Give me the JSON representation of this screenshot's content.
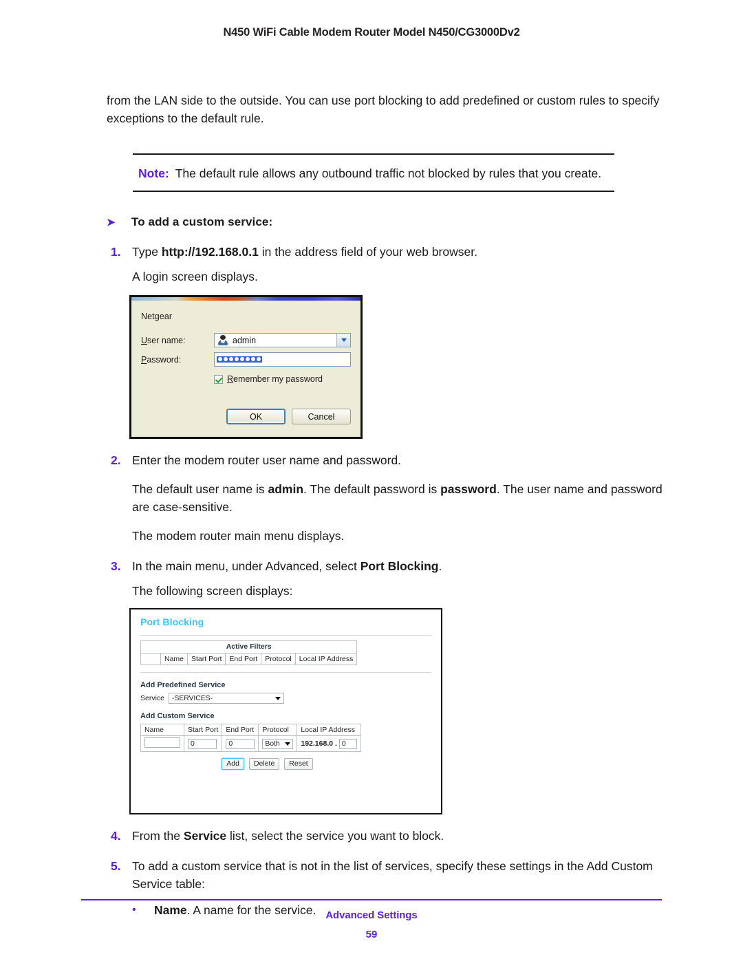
{
  "header": {
    "running_head": "N450 WiFi Cable Modem Router Model N450/CG3000Dv2"
  },
  "colors": {
    "accent_purple": "#5B1FE0",
    "router_title_blue": "#3FC2F5",
    "dialog_background": "#EDECD8"
  },
  "intro": {
    "paragraph": "from the LAN side to the outside. You can use port blocking to add predefined or custom rules to specify exceptions to the default rule."
  },
  "note": {
    "label": "Note:",
    "text": "The default rule allows any outbound traffic not blocked by rules that you create."
  },
  "procedure": {
    "arrow_glyph": "➤",
    "heading": "To add a custom service:"
  },
  "steps": [
    {
      "number": "1.",
      "lead": "Type ",
      "bold": "http://192.168.0.1",
      "tail": " in the address field of your web browser.",
      "follow": "A login screen displays."
    },
    {
      "number": "2.",
      "lead": "Enter the modem router user name and password.",
      "bold": "",
      "tail": "",
      "follow_1_a": "The default user name is ",
      "follow_1_b": "admin",
      "follow_1_c": ". The default password is ",
      "follow_1_d": "password",
      "follow_1_e": ". The user name and password are case-sensitive.",
      "follow_2": "The modem router main menu displays."
    },
    {
      "number": "3.",
      "lead": "In the main menu, under Advanced, select ",
      "bold": "Port Blocking",
      "tail": ".",
      "follow": "The following screen displays:"
    },
    {
      "number": "4.",
      "lead": "From the ",
      "bold": "Service",
      "tail": " list, select the service you want to block."
    },
    {
      "number": "5.",
      "lead": "To add a custom service that is not in the list of services, specify these settings in the Add Custom Service table:",
      "bold": "",
      "tail": ""
    }
  ],
  "bullets": [
    {
      "marker": "•",
      "bold": "Name",
      "text": ". A name for the service."
    }
  ],
  "login_dialog": {
    "app_name": "Netgear",
    "username_label_prefix": "U",
    "username_label_rest": "ser name:",
    "username_value": "admin",
    "username_icon": "user-icon",
    "password_label_prefix": "P",
    "password_label_rest": "assword:",
    "password_masked_count": 8,
    "remember_label_prefix": "R",
    "remember_label_rest": "emember my password",
    "remember_checked": true,
    "ok_label": "OK",
    "cancel_label": "Cancel"
  },
  "router_screen": {
    "title": "Port Blocking",
    "active_filters": {
      "caption": "Active Filters",
      "columns": [
        "",
        "Name",
        "Start Port",
        "End Port",
        "Protocol",
        "Local IP Address"
      ],
      "rows": []
    },
    "add_predefined": {
      "heading": "Add Predefined Service",
      "service_label": "Service",
      "service_value": "-SERVICES-"
    },
    "add_custom": {
      "heading": "Add Custom Service",
      "columns": [
        "Name",
        "Start Port",
        "End Port",
        "Protocol",
        "Local IP Address"
      ],
      "row": {
        "name": "",
        "start_port": "0",
        "end_port": "0",
        "protocol": "Both",
        "ip_prefix": "192.168.0 .",
        "ip_host": "0"
      }
    },
    "buttons": [
      {
        "label": "Add",
        "focused": true
      },
      {
        "label": "Delete",
        "focused": false
      },
      {
        "label": "Reset",
        "focused": false
      }
    ]
  },
  "footer": {
    "section": "Advanced Settings",
    "page_number": "59"
  }
}
